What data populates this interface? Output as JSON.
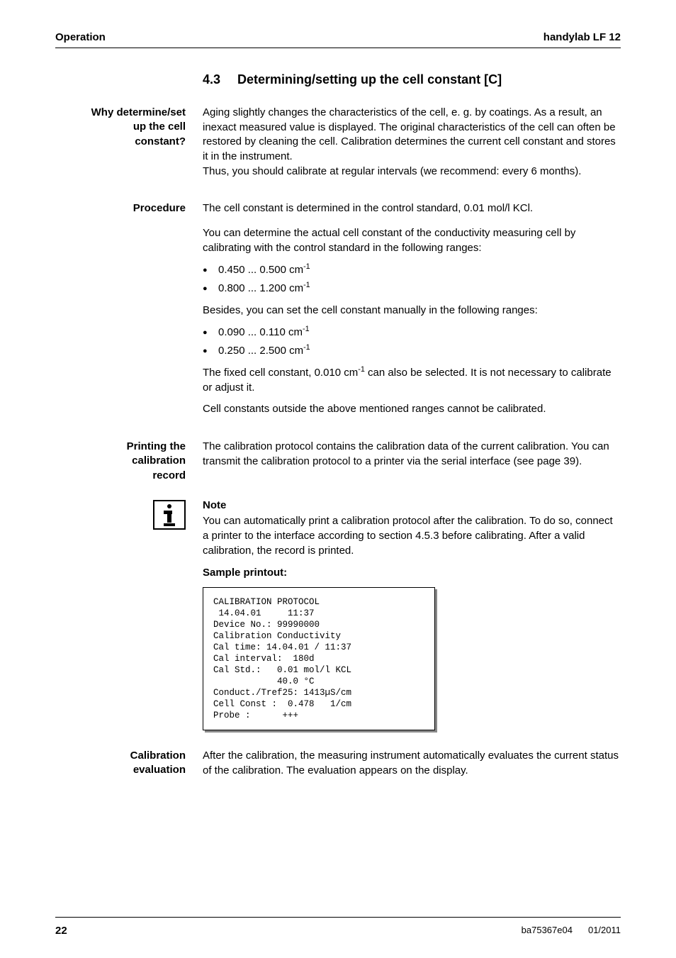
{
  "header": {
    "left": "Operation",
    "right": "handylab LF 12"
  },
  "section": {
    "number": "4.3",
    "title": "Determining/setting up the cell constant [C]"
  },
  "why": {
    "label_l1": "Why determine/set",
    "label_l2": "up the cell",
    "label_l3": "constant?",
    "para1": "Aging slightly changes the characteristics of the cell, e. g. by coatings. As a result, an inexact measured value is displayed. The original characteristics of the cell can often be restored by cleaning the cell. Calibration determines the current cell constant and stores it in the instrument.",
    "para2": "Thus, you should calibrate at regular intervals (we recommend: every 6 months)."
  },
  "procedure": {
    "label": "Procedure",
    "line1": "The cell constant is determined in the control standard, 0.01 mol/l KCl.",
    "line2": "You can determine the actual cell constant of the conductivity measuring cell by calibrating with the control standard in the following ranges:",
    "range_a_pre": "0.450 ... 0.500 cm",
    "range_b_pre": "0.800 ... 1.200 cm",
    "line3": "Besides, you can set the cell constant manually in the following ranges:",
    "range_c_pre": "0.090 ... 0.110 cm",
    "range_d_pre": "0.250 ... 2.500 cm",
    "exp": "-1",
    "fixed_a": "The fixed cell constant, 0.010 cm",
    "fixed_b": " can also be selected. It is not necessary to calibrate or adjust it.",
    "outside": "Cell constants outside the above mentioned ranges cannot be calibrated."
  },
  "printing": {
    "label_l1": "Printing the",
    "label_l2": "calibration",
    "label_l3": "record",
    "text": "The calibration protocol contains the calibration data of the current calibration. You can transmit the calibration protocol to a printer via the serial interface (see page 39)."
  },
  "note": {
    "title": "Note",
    "text": "You can automatically print a calibration protocol after the calibration. To do so, connect a printer to the interface according to section 4.5.3 before calibrating. After a valid calibration, the record is printed."
  },
  "sample": {
    "title": "Sample printout:",
    "lines": "CALIBRATION PROTOCOL\n 14.04.01     11:37\nDevice No.: 99990000\nCalibration Conductivity\nCal time: 14.04.01 / 11:37\nCal interval:  180d\nCal Std.:   0.01 mol/l KCL\n            40.0 °C\nConduct./Tref25: 1413µS/cm\nCell Const :  0.478   1/cm\nProbe :      +++"
  },
  "calib_eval": {
    "label_l1": "Calibration",
    "label_l2": "evaluation",
    "text": "After the calibration, the measuring instrument automatically evaluates the current status of the calibration. The evaluation appears on the display."
  },
  "footer": {
    "page": "22",
    "code": "ba75367e04",
    "date": "01/2011"
  }
}
